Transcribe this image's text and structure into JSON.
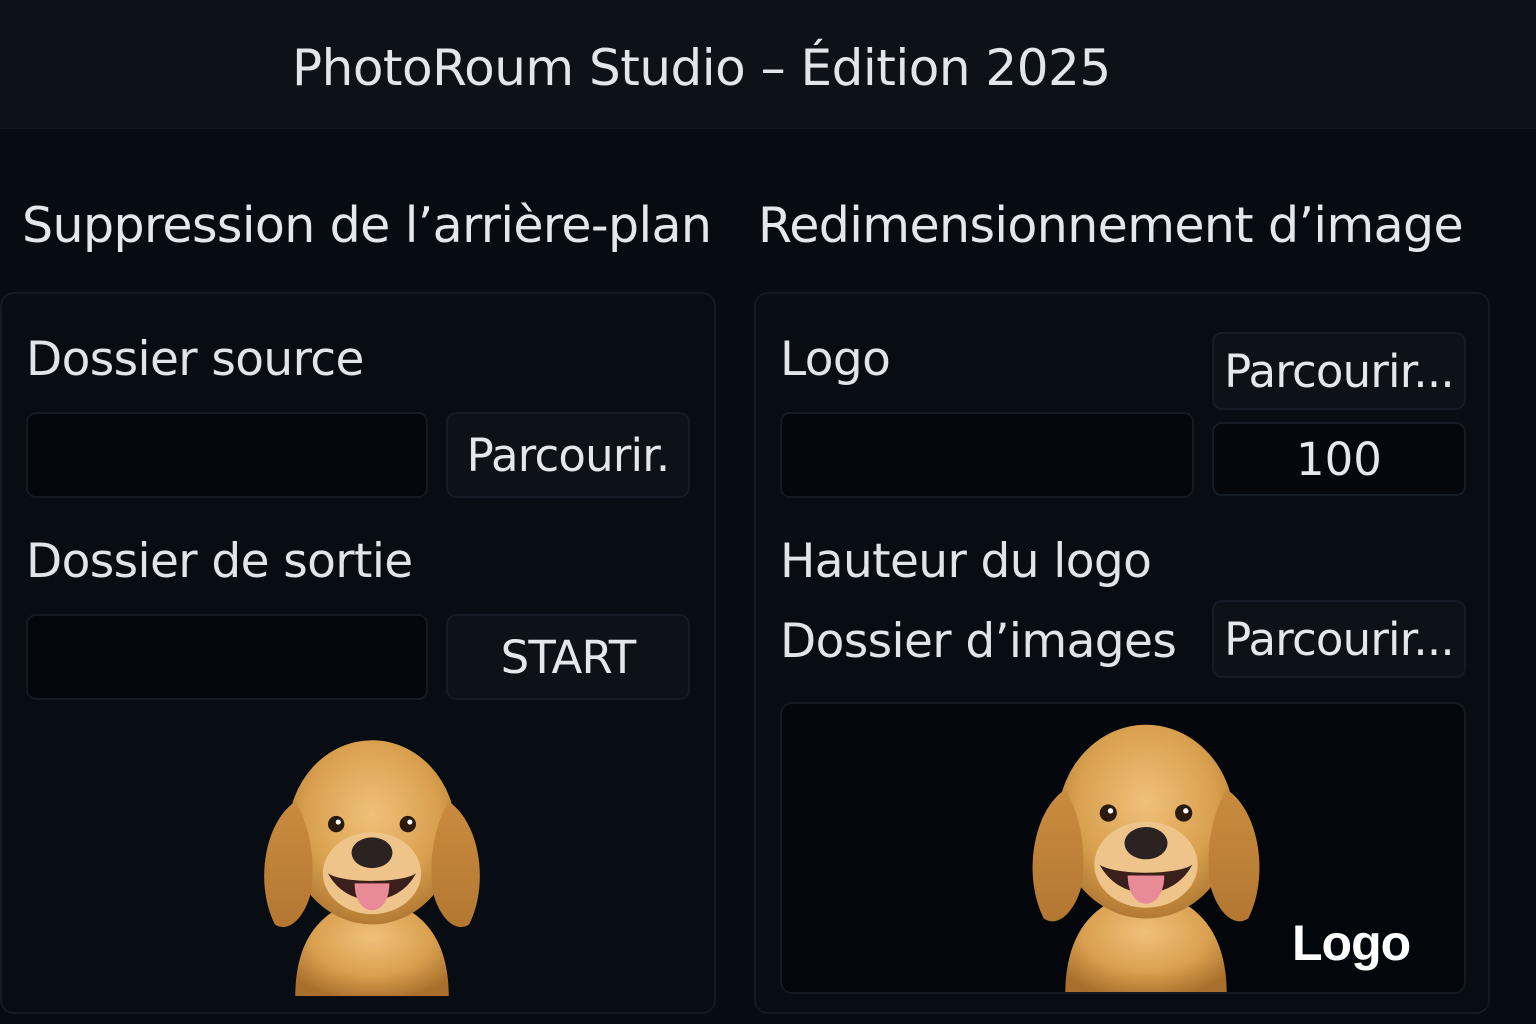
{
  "window": {
    "title": "PhotoRoum Studio – Édition 2025"
  },
  "background_removal": {
    "title": "Suppression de l’arrière-plan",
    "source_label": "Dossier source",
    "source_value": "",
    "browse_label": "Parcourir.",
    "output_label": "Dossier de sortie",
    "output_value": "",
    "start_label": "START",
    "preview_icon": "dog-photo"
  },
  "resize": {
    "title": "Redimensionnement d’image",
    "logo_label": "Logo",
    "logo_browse_label": "Parcourir...",
    "logo_value": "",
    "logo_height_value": "100",
    "logo_height_label": "Hauteur du logo",
    "images_folder_label": "Dossier d’images",
    "images_browse_label": "Parcourir...",
    "preview_icon": "dog-photo",
    "watermark_text": "Logo"
  },
  "colors": {
    "background": "#070b12",
    "dog_fur": "#d9a04f",
    "text": "#e2e5ea"
  }
}
